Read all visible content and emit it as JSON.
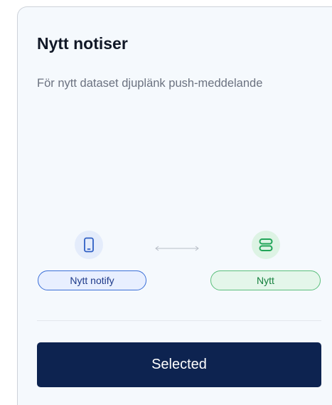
{
  "card": {
    "title": "Nytt notiser",
    "description": "För nytt dataset djuplänk push-meddelande"
  },
  "integration": {
    "source": {
      "label": "Nytt notify",
      "icon": "smartphone-icon",
      "color": "#3b6fd8"
    },
    "connector_icon": "double-arrow-icon",
    "target": {
      "label": "Nytt",
      "icon": "server-icon",
      "color": "#22a559"
    }
  },
  "action": {
    "button_label": "Selected",
    "button_color": "#0d2350"
  }
}
